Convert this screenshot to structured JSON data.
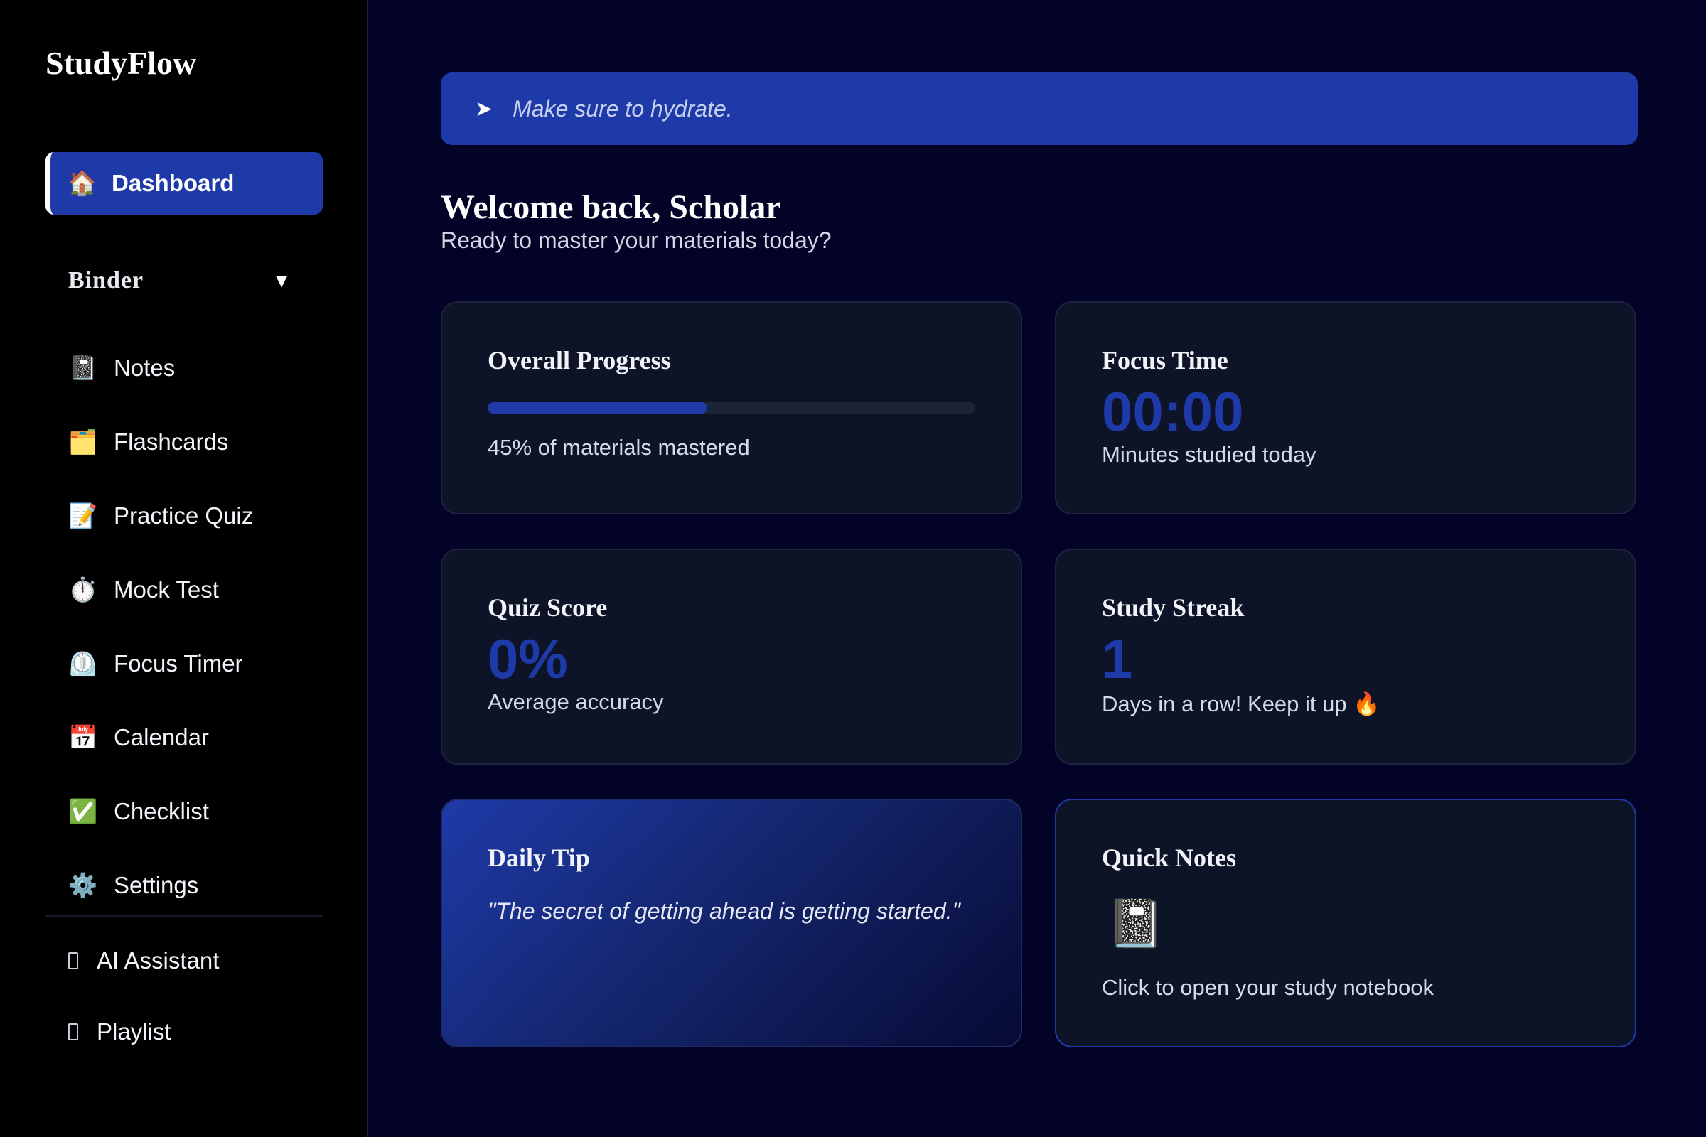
{
  "app": {
    "name": "StudyFlow"
  },
  "sidebar": {
    "active": {
      "label": "Dashboard",
      "icon": "🏠",
      "icon_name": "home-icon"
    },
    "section": {
      "title": "Binder",
      "caret": "▼"
    },
    "items": [
      {
        "label": "Notes",
        "icon": "📓",
        "icon_name": "notebook-icon"
      },
      {
        "label": "Flashcards",
        "icon": "🗂️",
        "icon_name": "card-index-dividers-icon"
      },
      {
        "label": "Practice Quiz",
        "icon": "📝",
        "icon_name": "memo-icon"
      },
      {
        "label": "Mock Test",
        "icon": "⏱️",
        "icon_name": "stopwatch-icon"
      },
      {
        "label": "Focus Timer",
        "icon": "⏲️",
        "icon_name": "timer-clock-icon"
      },
      {
        "label": "Calendar",
        "icon": "📅",
        "icon_name": "calendar-icon"
      },
      {
        "label": "Checklist",
        "icon": "✅",
        "icon_name": "check-mark-icon"
      },
      {
        "label": "Settings",
        "icon": "⚙️",
        "icon_name": "gear-icon"
      }
    ],
    "bottom": [
      {
        "label": "AI Assistant",
        "icon_name": "ai-assistant-icon"
      },
      {
        "label": "Playlist",
        "icon_name": "playlist-icon"
      }
    ]
  },
  "banner": {
    "arrow": "➤",
    "text": "Make sure to hydrate."
  },
  "header": {
    "welcome": "Welcome back, Scholar",
    "subtitle": "Ready to master your materials today?"
  },
  "cards": {
    "progress": {
      "title": "Overall Progress",
      "percent": 45,
      "caption": "45% of materials mastered"
    },
    "focus": {
      "title": "Focus Time",
      "value": "00:00",
      "caption": "Minutes studied today"
    },
    "quiz": {
      "title": "Quiz Score",
      "value": "0%",
      "caption": "Average accuracy"
    },
    "streak": {
      "title": "Study Streak",
      "value": "1",
      "caption": "Days in a row! Keep it up 🔥"
    },
    "tip": {
      "title": "Daily Tip",
      "quote": "\"The secret of getting ahead is getting started.\""
    },
    "notes": {
      "title": "Quick Notes",
      "icon": "📓",
      "caption": "Click to open your study notebook"
    }
  },
  "colors": {
    "accent": "#1e3aa8",
    "background": "#020326",
    "sidebar": "#000000",
    "card": "#0e1428"
  }
}
